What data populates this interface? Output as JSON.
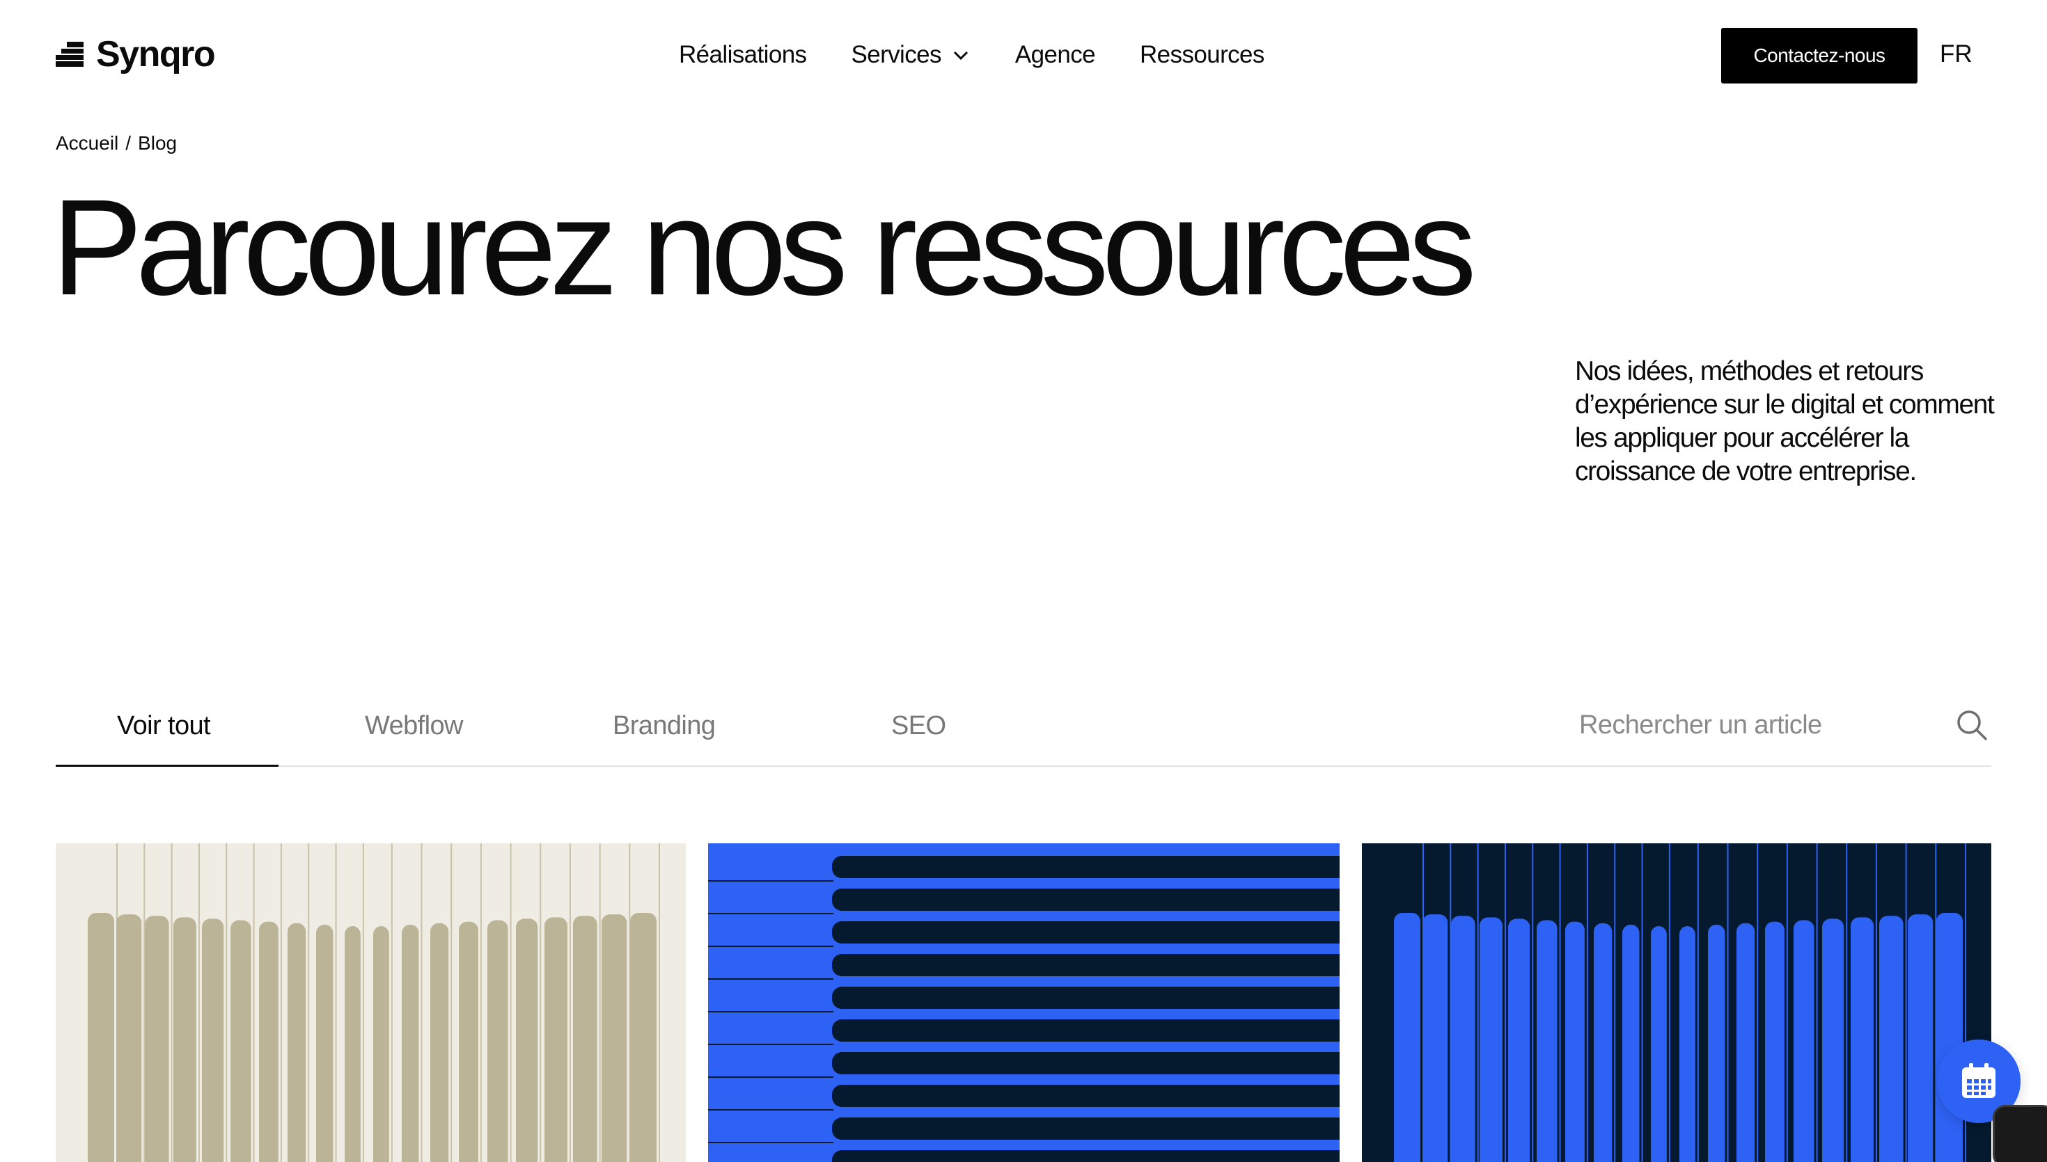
{
  "brand": {
    "name": "Synqro"
  },
  "nav": {
    "items": [
      {
        "label": "Réalisations"
      },
      {
        "label": "Services"
      },
      {
        "label": "Agence"
      },
      {
        "label": "Ressources"
      }
    ]
  },
  "header": {
    "contact_label": "Contactez-nous",
    "language": "FR"
  },
  "breadcrumb": {
    "home": "Accueil",
    "separator": "/",
    "current": "Blog"
  },
  "hero": {
    "title": "Parcourez nos ressources",
    "description": "Nos idées, méthodes et retours d’expérience sur le digital et comment les appliquer pour accélérer la croissance de votre entreprise."
  },
  "filters": {
    "tabs": [
      {
        "label": "Voir tout",
        "active": true
      },
      {
        "label": "Webflow",
        "active": false
      },
      {
        "label": "Branding",
        "active": false
      },
      {
        "label": "SEO",
        "active": false
      }
    ],
    "search_placeholder": "Rechercher un article"
  },
  "cards": [
    {
      "theme": "beige-vertical-stripes",
      "bg": "#efece3",
      "fg": "#bcb496"
    },
    {
      "theme": "blue-horizontal-bars",
      "bg": "#2e62f5",
      "fg": "#051a2e"
    },
    {
      "theme": "navy-blue-vertical-stripes",
      "bg": "#051a2e",
      "fg": "#2e62f5"
    }
  ],
  "colors": {
    "accent": "#2e62f5",
    "dark": "#000000",
    "muted": "#787878"
  },
  "icons": {
    "calendar": "calendar-icon",
    "search": "search-icon",
    "chevron": "chevron-down-icon"
  }
}
